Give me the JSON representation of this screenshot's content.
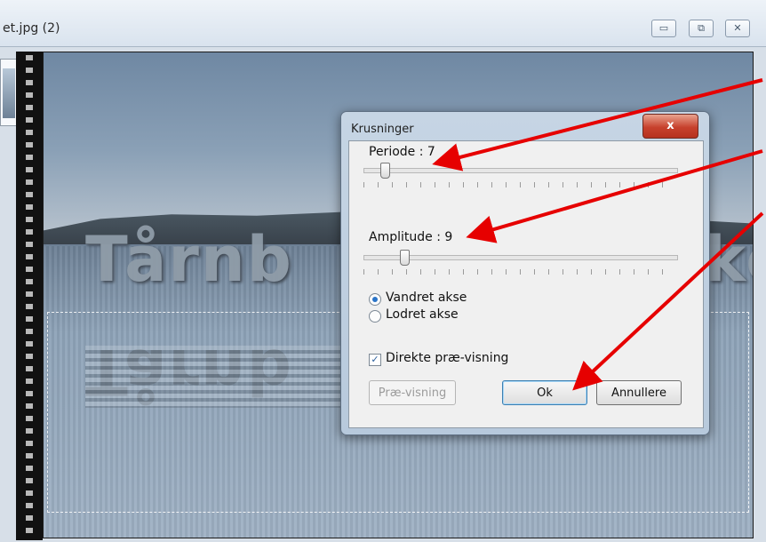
{
  "window": {
    "title": "et.jpg (2)",
    "controls": {
      "minimize": "▭",
      "restore": "⧉",
      "close": "✕"
    }
  },
  "canvas": {
    "watermark_text": "Tårnb",
    "watermark_text_tail": "kke"
  },
  "dialog": {
    "title": "Krusninger",
    "close_label": "x",
    "period_label": "Periode : 7",
    "period_value": 7,
    "amplitude_label": "Amplitude : 9",
    "amplitude_value": 9,
    "radio_horizontal": "Vandret akse",
    "radio_vertical": "Lodret akse",
    "selected_axis": "horizontal",
    "checkbox_label": "Direkte præ-visning",
    "checkbox_checked": true,
    "preview_button": "Præ-visning",
    "ok_button": "Ok",
    "cancel_button": "Annullere"
  },
  "annotation": {
    "arrow_color": "#e60000"
  }
}
